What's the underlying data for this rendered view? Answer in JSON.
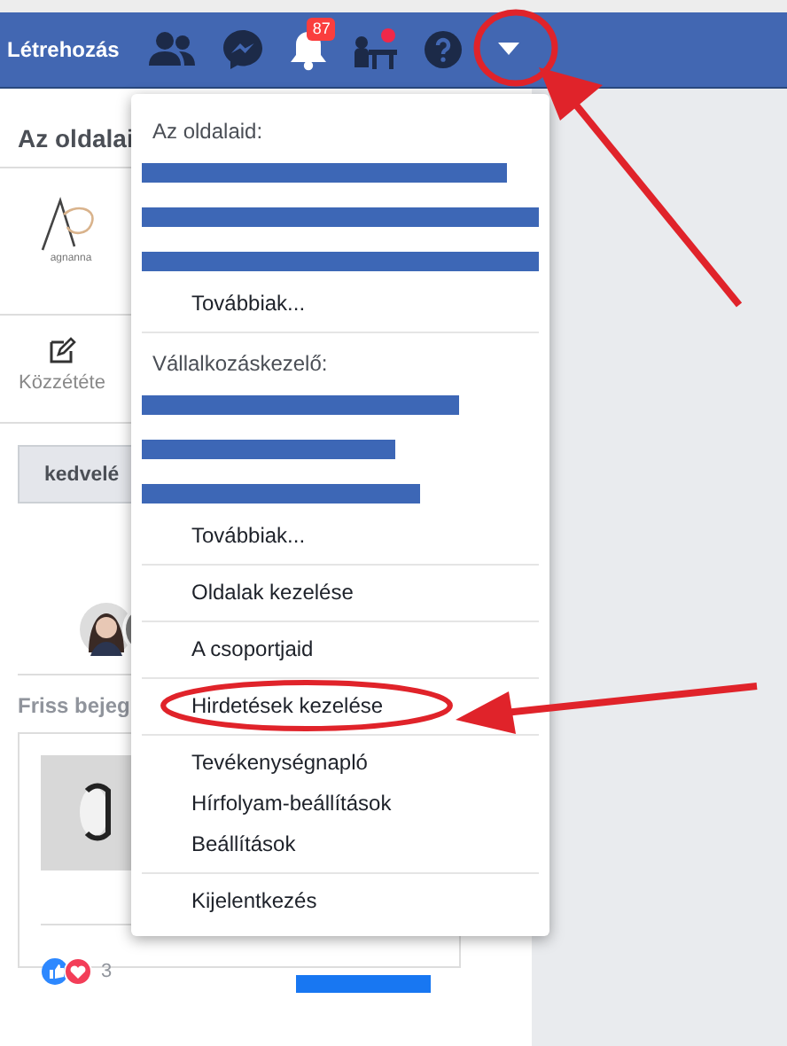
{
  "top_bar": {
    "create_label": "Létrehozás",
    "notification_badge": "87",
    "dropdown_circled": true
  },
  "left_panel": {
    "title": "Az oldalai",
    "logo_text": "agnanna",
    "publish_label": "Közzététe",
    "like_button": "kedvelé",
    "recent_title": "Friss bejeg",
    "reaction_count": "3"
  },
  "menu": {
    "sections": [
      {
        "heading": "Az oldalaid:",
        "rows": [
          {
            "kind": "redacted"
          },
          {
            "kind": "redacted"
          },
          {
            "kind": "redacted"
          },
          {
            "kind": "link",
            "label": "Továbbiak...",
            "circled": false
          }
        ]
      },
      {
        "heading": "Vállalkozáskezelő:",
        "rows": [
          {
            "kind": "redacted"
          },
          {
            "kind": "redacted"
          },
          {
            "kind": "redacted"
          },
          {
            "kind": "link",
            "label": "Továbbiak...",
            "circled": false
          }
        ]
      },
      {
        "rows": [
          {
            "kind": "link",
            "label": "Oldalak kezelése",
            "circled": false
          }
        ]
      },
      {
        "rows": [
          {
            "kind": "link",
            "label": "A csoportjaid",
            "circled": false
          }
        ]
      },
      {
        "rows": [
          {
            "kind": "link",
            "label": "Hirdetések kezelése",
            "circled": true
          }
        ]
      },
      {
        "rows": [
          {
            "kind": "link",
            "label": "Tevékenységnapló",
            "circled": false
          },
          {
            "kind": "link",
            "label": "Hírfolyam-beállítások",
            "circled": false
          },
          {
            "kind": "link",
            "label": "Beállítások",
            "circled": false
          }
        ]
      },
      {
        "rows": [
          {
            "kind": "link",
            "label": "Kijelentkezés",
            "circled": false
          }
        ]
      }
    ]
  }
}
